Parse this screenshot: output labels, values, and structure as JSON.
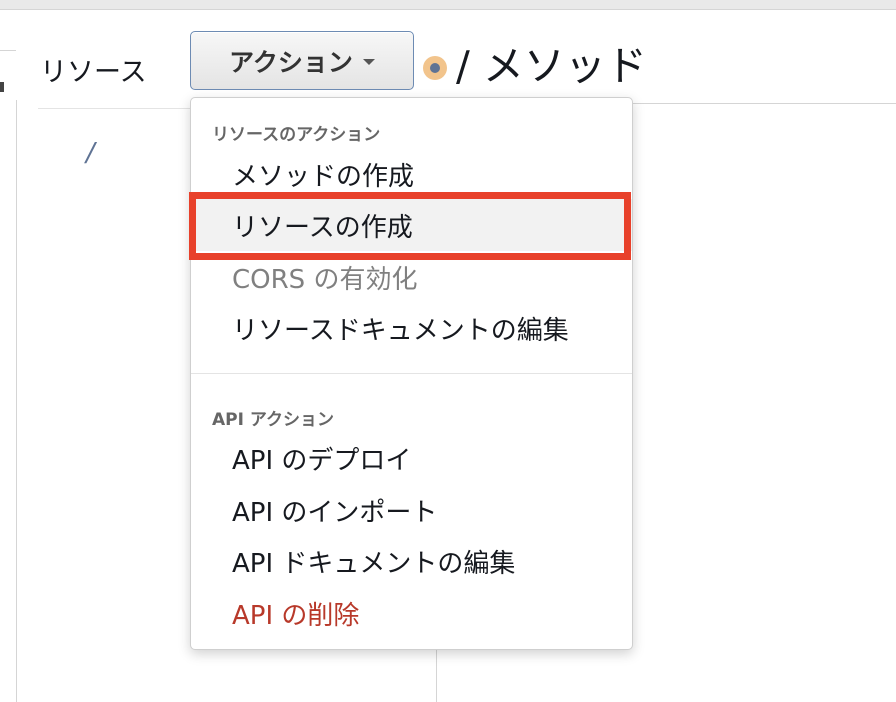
{
  "resources_panel": {
    "title": "リソース",
    "root_path": "/"
  },
  "actions_button": {
    "label": "アクション"
  },
  "methods_panel": {
    "title": "/ メソッド"
  },
  "dropdown": {
    "sections": [
      {
        "header": "リソースのアクション",
        "items": [
          {
            "label": "メソッドの作成",
            "state": "normal"
          },
          {
            "label": "リソースの作成",
            "state": "highlighted"
          },
          {
            "label": "CORS の有効化",
            "state": "disabled"
          },
          {
            "label": "リソースドキュメントの編集",
            "state": "normal"
          }
        ]
      },
      {
        "header": "API アクション",
        "items": [
          {
            "label": "API のデプロイ",
            "state": "normal"
          },
          {
            "label": "API のインポート",
            "state": "normal"
          },
          {
            "label": "API ドキュメントの編集",
            "state": "normal"
          },
          {
            "label": "API の削除",
            "state": "danger"
          }
        ]
      }
    ]
  },
  "colors": {
    "highlight_border": "#e8412b",
    "danger_text": "#b8392a",
    "disabled_text": "#808080",
    "button_border": "#6d8bb3",
    "root_link": "#5f7394"
  }
}
